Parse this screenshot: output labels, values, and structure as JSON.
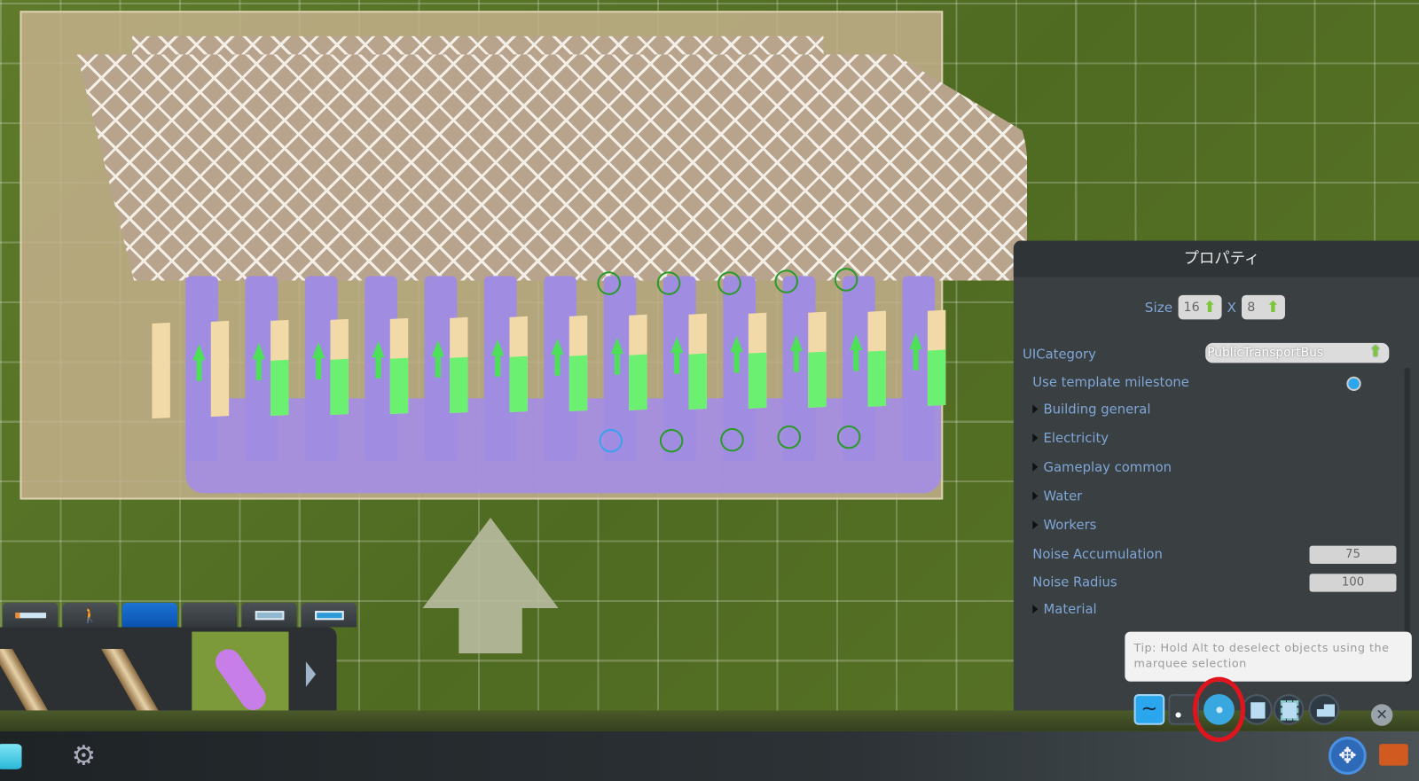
{
  "properties_panel": {
    "title": "プロパティ",
    "size_label": "Size",
    "size_width": "16",
    "size_separator": "X",
    "size_length": "8",
    "ui_category_label": "UICategory",
    "ui_category_value": "PublicTransportBus",
    "use_template_milestone_label": "Use template milestone",
    "use_template_milestone_checked": true,
    "sections": [
      "Building general",
      "Electricity",
      "Gameplay common",
      "Water",
      "Workers"
    ],
    "noise_accumulation_label": "Noise Accumulation",
    "noise_accumulation_value": "75",
    "noise_radius_label": "Noise Radius",
    "noise_radius_value": "100",
    "material_label": "Material"
  },
  "tip": "Tip: Hold Alt to deselect objects using the marquee selection",
  "tools": [
    "bezier-tool-icon",
    "node-tool-icon",
    "point-select-icon",
    "marquee-select-icon",
    "multi-marquee-icon",
    "building-select-icon"
  ],
  "active_tool": "point-select-icon",
  "colors": {
    "accent": "#1c74d4",
    "label": "#7fa6d6",
    "highlight": "#e0141c",
    "lane": "#a08ce0",
    "arrow": "#4fe05a"
  },
  "asset_tabs": [
    "road-tab",
    "pedestrian-tab",
    "selected-tab",
    "empty-tab",
    "bus-stop-tab",
    "tram-stop-tab"
  ],
  "active_asset_tab": 2
}
